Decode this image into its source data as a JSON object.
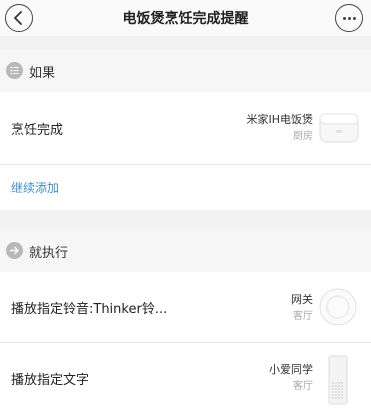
{
  "header": {
    "title": "电饭煲烹饪完成提醒",
    "back_icon": "chevron-left-icon",
    "more_icon": "more-horizontal-icon"
  },
  "if_section": {
    "label": "如果",
    "icon": "list-icon",
    "conditions": [
      {
        "label": "烹饪完成",
        "device": "米家IH电饭煲",
        "room": "厨房",
        "device_icon": "rice-cooker-icon"
      }
    ],
    "add_label": "继续添加"
  },
  "then_section": {
    "label": "就执行",
    "icon": "arrow-right-circle-icon",
    "actions": [
      {
        "label": "播放指定铃音:Thinker铃...",
        "device": "网关",
        "room": "客厅",
        "device_icon": "gateway-icon"
      },
      {
        "label": "播放指定文字",
        "device": "小爱同学",
        "room": "客厅",
        "device_icon": "smart-speaker-icon"
      }
    ]
  },
  "colors": {
    "accent": "#3c8fd6",
    "background": "#f2f2f2"
  }
}
